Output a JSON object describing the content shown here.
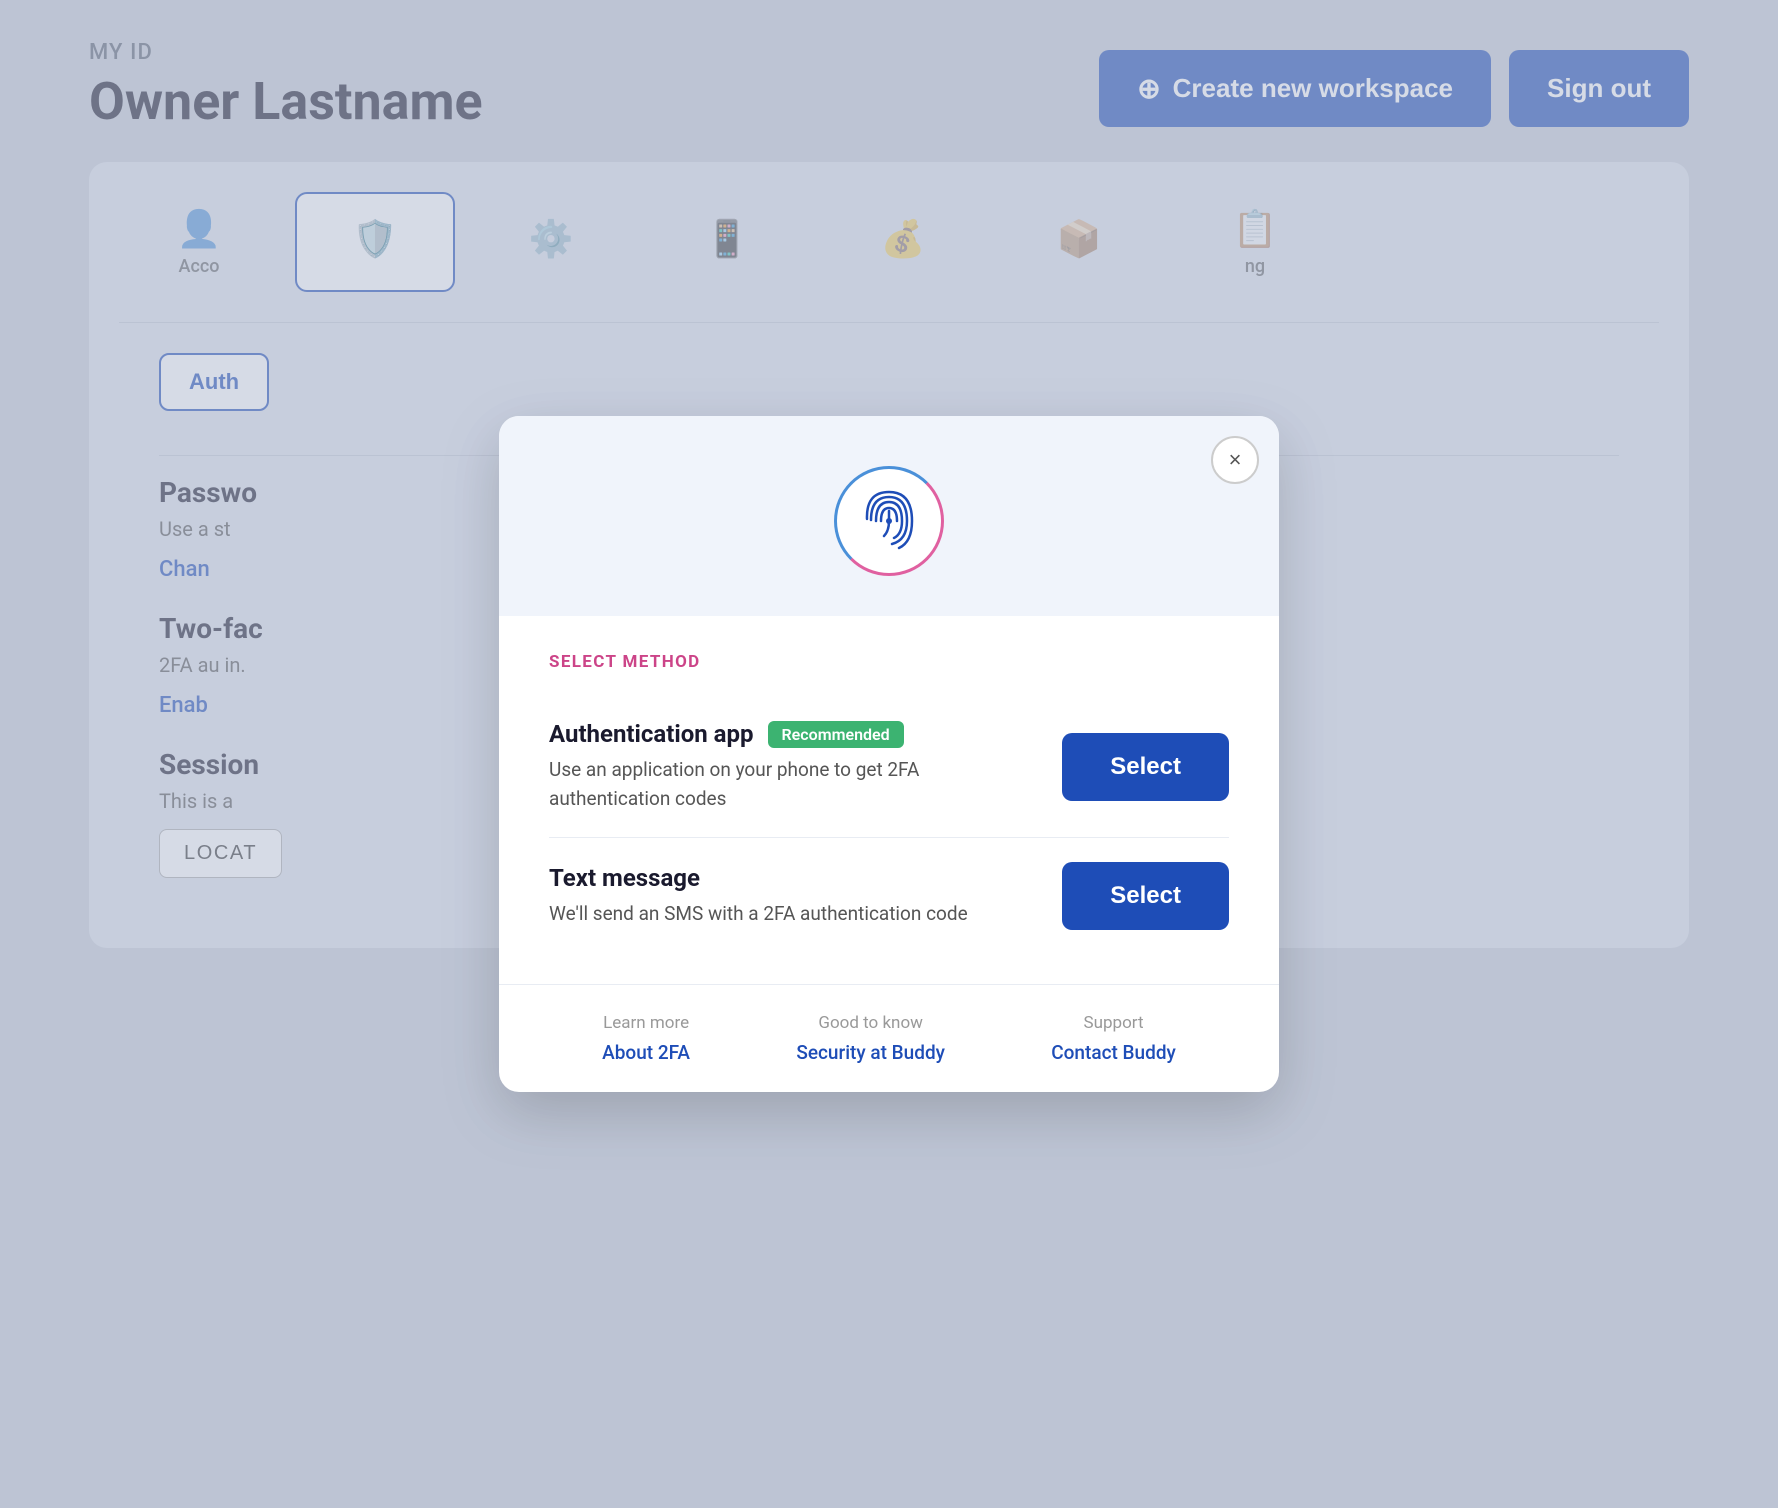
{
  "header": {
    "my_id_label": "MY ID",
    "owner_name": "Owner Lastname",
    "create_workspace_label": "Create new workspace",
    "sign_out_label": "Sign out"
  },
  "tabs": [
    {
      "icon": "👤",
      "label": "Acco",
      "active": false
    },
    {
      "icon": "🛡️",
      "label": "",
      "active": true
    },
    {
      "icon": "⚙️",
      "label": "",
      "active": false
    },
    {
      "icon": "📱",
      "label": "",
      "active": false
    },
    {
      "icon": "💰",
      "label": "",
      "active": false
    },
    {
      "icon": "📦",
      "label": "",
      "active": false
    },
    {
      "icon": "📋",
      "label": "ng",
      "active": false
    }
  ],
  "sections": {
    "auth_tab_label": "Auth",
    "password_title": "Passwo",
    "password_desc": "Use a st",
    "change_link": "Chan",
    "two_fa_title": "Two-fac",
    "two_fa_desc": "2FA au",
    "enable_link": "Enab",
    "two_fa_suffix": "in.",
    "sessions_title": "Session",
    "sessions_desc": "This is a",
    "location_btn": "LOCAT"
  },
  "modal": {
    "close_label": "×",
    "select_method_label": "SELECT METHOD",
    "auth_app": {
      "title": "Authentication app",
      "recommended_badge": "Recommended",
      "description": "Use an application on your phone to get 2FA authentication codes",
      "select_btn": "Select"
    },
    "text_message": {
      "title": "Text message",
      "description": "We'll send an SMS with a 2FA authentication code",
      "select_btn": "Select"
    },
    "footer": {
      "learn_more_label": "Learn more",
      "learn_more_link": "About 2FA",
      "good_to_know_label": "Good to know",
      "good_to_know_link": "Security at Buddy",
      "support_label": "Support",
      "support_link": "Contact Buddy"
    }
  },
  "colors": {
    "primary": "#1e4db7",
    "recommended": "#3cb371",
    "pink": "#e060a0"
  }
}
